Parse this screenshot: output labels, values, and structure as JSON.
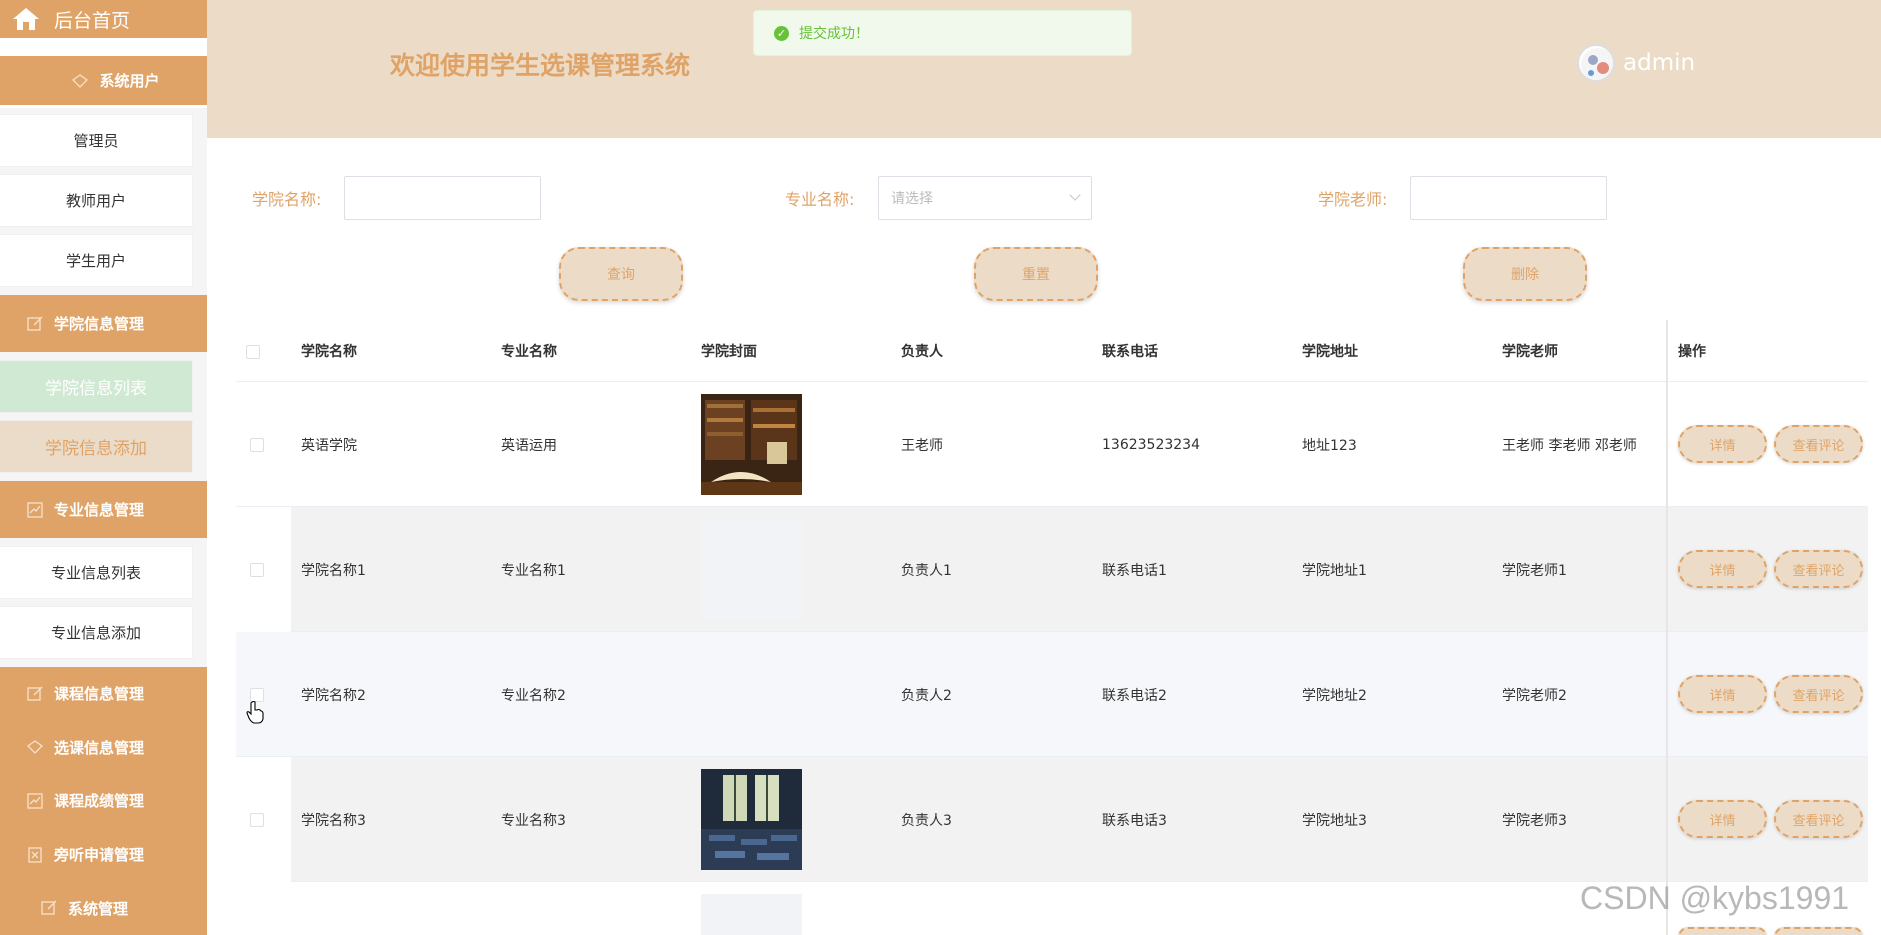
{
  "sidebar": {
    "home": "后台首页",
    "groups": [
      {
        "label": "系统用户",
        "items": [
          "管理员",
          "教师用户",
          "学生用户"
        ]
      },
      {
        "label": "学院信息管理",
        "items": [
          "学院信息列表",
          "学院信息添加"
        ]
      },
      {
        "label": "专业信息管理",
        "items": [
          "专业信息列表",
          "专业信息添加"
        ]
      },
      {
        "label": "课程信息管理"
      },
      {
        "label": "选课信息管理"
      },
      {
        "label": "课程成绩管理"
      },
      {
        "label": "旁听申请管理"
      },
      {
        "label": "系统管理"
      }
    ]
  },
  "header": {
    "title": "欢迎使用学生选课管理系统",
    "user": "admin"
  },
  "toast": {
    "message": "提交成功！"
  },
  "search": {
    "college_label": "学院名称:",
    "major_label": "专业名称:",
    "major_placeholder": "请选择",
    "teacher_label": "学院老师:",
    "query": "查询",
    "reset": "重置",
    "delete": "删除"
  },
  "table": {
    "columns": [
      "学院名称",
      "专业名称",
      "学院封面",
      "负责人",
      "联系电话",
      "学院地址",
      "学院老师",
      "操作"
    ],
    "rows": [
      {
        "college": "英语学院",
        "major": "英语运用",
        "head": "王老师",
        "phone": "13623523234",
        "address": "地址123",
        "teachers": "王老师 李老师 邓老师"
      },
      {
        "college": "学院名称1",
        "major": "专业名称1",
        "head": "负责人1",
        "phone": "联系电话1",
        "address": "学院地址1",
        "teachers": "学院老师1"
      },
      {
        "college": "学院名称2",
        "major": "专业名称2",
        "head": "负责人2",
        "phone": "联系电话2",
        "address": "学院地址2",
        "teachers": "学院老师2"
      },
      {
        "college": "学院名称3",
        "major": "专业名称3",
        "head": "负责人3",
        "phone": "联系电话3",
        "address": "学院地址3",
        "teachers": "学院老师3"
      }
    ],
    "detail": "详情",
    "comments": "查看评论"
  },
  "watermark": "CSDN @kybs1991",
  "colors": {
    "accent": "#e0a367",
    "header_bg": "#ecdcc7",
    "success": "#67c23a"
  }
}
